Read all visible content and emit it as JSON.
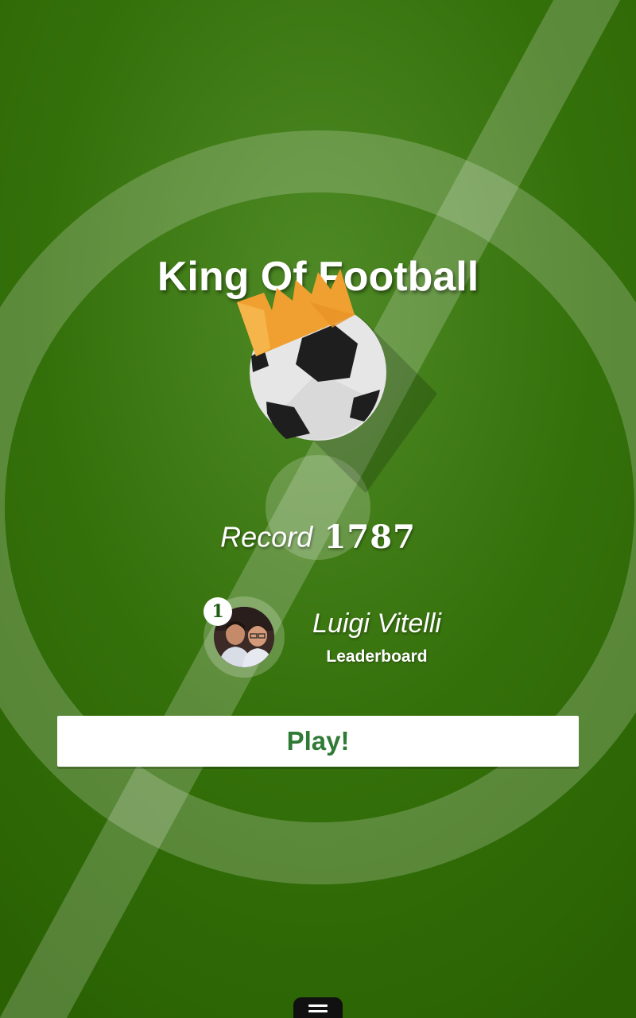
{
  "app": {
    "title": "King Of Football"
  },
  "record": {
    "label": "Record",
    "value": "1787"
  },
  "leaderboard": {
    "rank": "1",
    "player_name": "Luigi Vitelli",
    "link_label": "Leaderboard"
  },
  "actions": {
    "play_label": "Play!"
  },
  "icons": {
    "logo": "crowned-football-icon",
    "avatar": "player-avatar",
    "menu_handle": "menu-handle-icon"
  },
  "colors": {
    "field_green": "#2f6a06",
    "field_lines": "#ffffff",
    "button_text": "#2f7a35",
    "crown": "#f0a030"
  }
}
